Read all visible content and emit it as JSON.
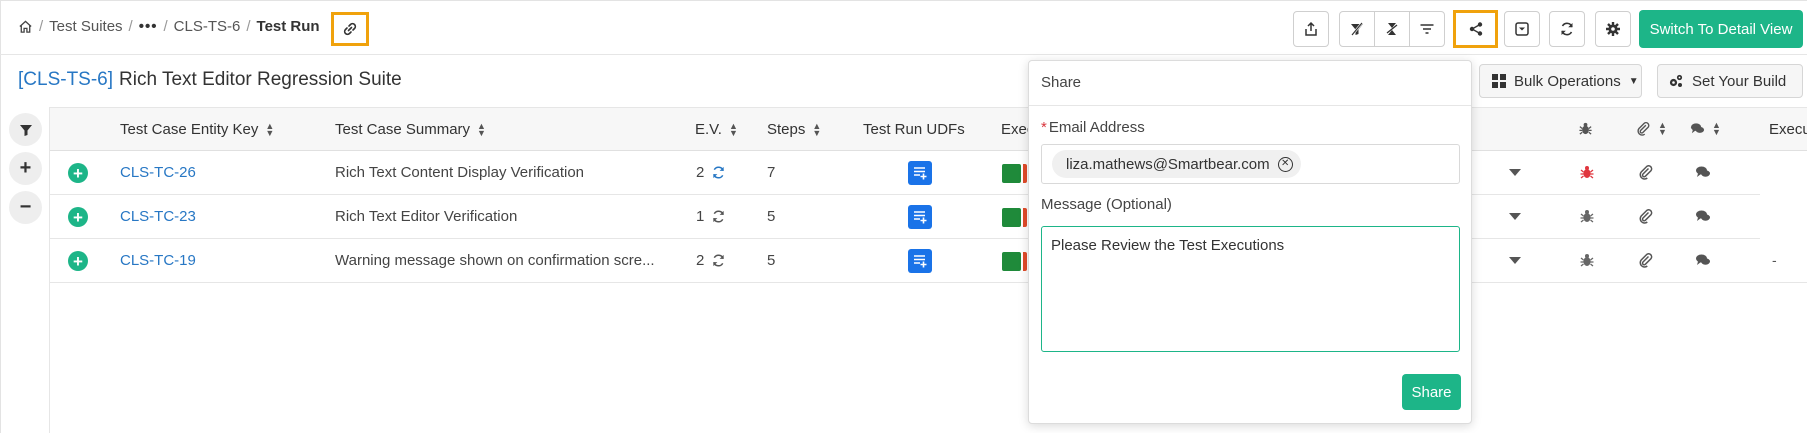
{
  "breadcrumb": {
    "home_icon": "home-icon",
    "items": [
      "Test Suites",
      "CLS-TS-6"
    ],
    "ellipsis": "•••",
    "current": "Test Run"
  },
  "toolbar": {
    "icons": [
      "export-icon",
      "clear-filter-icon",
      "sort-toggle-icon",
      "filter-icon",
      "share-icon",
      "collapse-icon",
      "refresh-icon",
      "settings-icon"
    ],
    "switch_label": "Switch To Detail View"
  },
  "title": {
    "key": "[CLS-TS-6]",
    "name": "Rich Text Editor Regression Suite"
  },
  "actions": {
    "bulk_label": "Bulk Operations",
    "build_label": "Set Your Build"
  },
  "table": {
    "headers": {
      "entity_key": "Test Case Entity Key",
      "summary": "Test Case Summary",
      "ev": "E.V.",
      "steps": "Steps",
      "udfs": "Test Run UDFs",
      "exec": "Exec",
      "exec2": "Execu"
    },
    "rows": [
      {
        "key": "CLS-TC-26",
        "summary": "Rich Text Content Display Verification",
        "ev": "2",
        "steps": "7",
        "last": ""
      },
      {
        "key": "CLS-TC-23",
        "summary": "Rich Text Editor Verification",
        "ev": "1",
        "steps": "5",
        "last": ""
      },
      {
        "key": "CLS-TC-19",
        "summary": "Warning message shown on confirmation scre...",
        "ev": "2",
        "steps": "5",
        "last": "-"
      }
    ]
  },
  "share_popover": {
    "title": "Share",
    "email_label": "Email Address",
    "required_mark": "*",
    "email_value": "liza.mathews@Smartbear.com",
    "message_label": "Message (Optional)",
    "message_value": "Please Review the Test Executions",
    "submit_label": "Share"
  },
  "colors": {
    "accent": "#1db588",
    "link": "#2777c4",
    "highlight": "#f0a20c",
    "exec_pass": "#1f8a3a",
    "exec_fail": "#e04b2a",
    "udf": "#1a73e8"
  }
}
